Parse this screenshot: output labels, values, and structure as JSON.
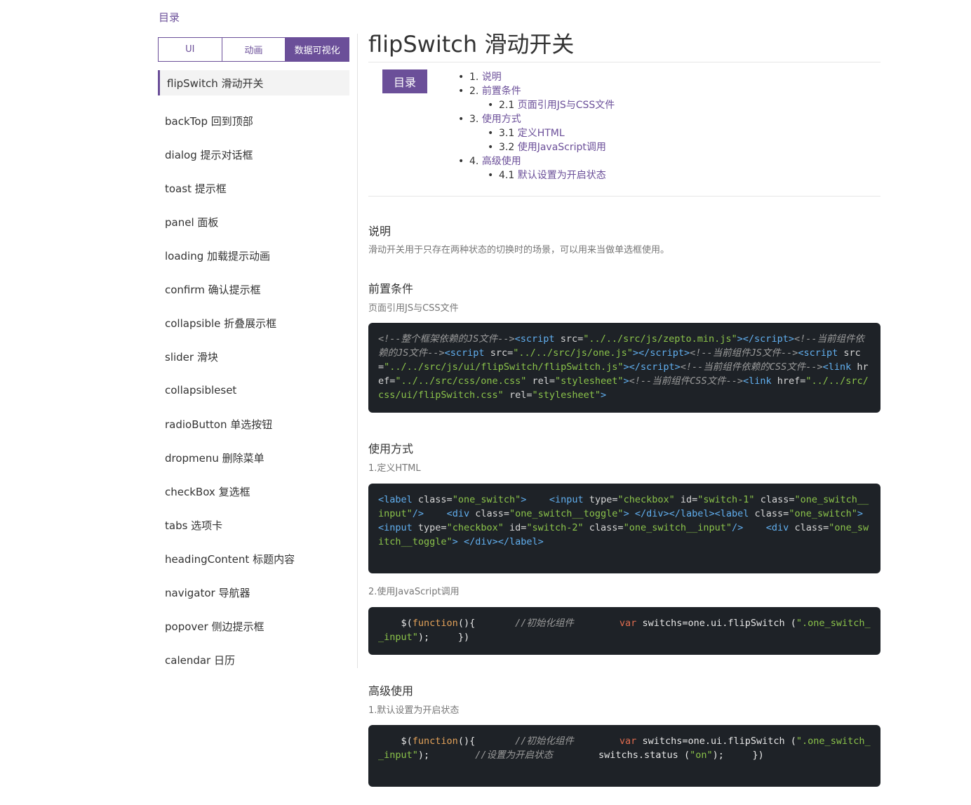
{
  "sidebar": {
    "title": "目录",
    "tabs": [
      "UI",
      "动画",
      "数据可视化"
    ],
    "active_tab": "数据可视化",
    "items": [
      "flipSwitch 滑动开关",
      "backTop 回到顶部",
      "dialog 提示对话框",
      "toast 提示框",
      "panel 面板",
      "loading 加载提示动画",
      "confirm 确认提示框",
      "collapsible 折叠展示框",
      "slider 滑块",
      "collapsibleset",
      "radioButton 单选按钮",
      "dropmenu 删除菜单",
      "checkBox 复选框",
      "tabs 选项卡",
      "headingContent 标题内容",
      "navigator 导航器",
      "popover 侧边提示框",
      "calendar 日历"
    ],
    "active_item": "flipSwitch 滑动开关"
  },
  "main": {
    "title": "flipSwitch 滑动开关",
    "toc_button": "目录",
    "toc": [
      {
        "num": "1.",
        "text": "说明",
        "level": 1
      },
      {
        "num": "2.",
        "text": "前置条件",
        "level": 1
      },
      {
        "num": "2.1",
        "text": "页面引用JS与CSS文件",
        "level": 2
      },
      {
        "num": "3.",
        "text": "使用方式",
        "level": 1
      },
      {
        "num": "3.1",
        "text": "定义HTML",
        "level": 2
      },
      {
        "num": "3.2",
        "text": "使用JavaScript调用",
        "level": 2
      },
      {
        "num": "4.",
        "text": "高级使用",
        "level": 1
      },
      {
        "num": "4.1",
        "text": "默认设置为开启状态",
        "level": 2
      }
    ],
    "sections": {
      "s1_title": "说明",
      "s1_desc": "滑动开关用于只存在两种状态的切换时的场景，可以用来当做单选框使用。",
      "s2_title": "前置条件",
      "s2_sub": "页面引用JS与CSS文件",
      "s3_title": "使用方式",
      "s3_sub1": "1.定义HTML",
      "s3_sub2": "2.使用JavaScript调用",
      "s4_title": "高级使用",
      "s4_sub": "1.默认设置为开启状态"
    },
    "code": {
      "c1": {
        "com1": "<!--整个框架依赖的JS文件-->",
        "com2": "<!--当前组件依赖的JS文件-->",
        "com3": "<!--当前组件JS文件-->",
        "com4": "<!--当前组件依赖的CSS文件-->",
        "com5": "<!--当前组件CSS文件-->",
        "src1": "\"../../src/js/zepto.min.js\"",
        "src2": "\"../../src/js/one.js\"",
        "src3": "\"../../src/js/ui/flipSwitch/flipSwitch.js\"",
        "href1": "\"../../src/css/one.css\"",
        "href2": "\"../../src/css/ui/flipSwitch.css\"",
        "rel": "\"stylesheet\""
      },
      "c2": {
        "cls_switch": "\"one_switch\"",
        "type_cb": "\"checkbox\"",
        "id1": "\"switch-1\"",
        "id2": "\"switch-2\"",
        "cls_input": "\"one_switch__input\"",
        "cls_toggle": "\"one_switch__toggle\""
      },
      "c3": {
        "comment": "//初始化组件",
        "sel": "\".one_switch__input\""
      },
      "c4": {
        "comment1": "//初始化组件",
        "comment2": "//设置为开启状态",
        "sel": "\".one_switch__input\"",
        "on": "\"on\""
      }
    }
  }
}
